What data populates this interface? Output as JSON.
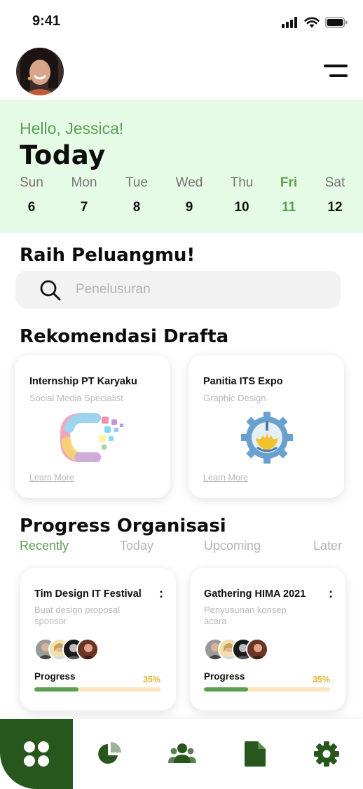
{
  "status_bar": {
    "time": "9:41",
    "icons": [
      "signal-icon",
      "wifi-icon",
      "battery-icon"
    ]
  },
  "header": {
    "avatar": "profile-avatar",
    "menu_icon": "hamburger-menu-icon"
  },
  "today": {
    "greeting": "Hello, Jessica!",
    "title": "Today",
    "days": [
      {
        "name": "Sun",
        "num": "6"
      },
      {
        "name": "Mon",
        "num": "7"
      },
      {
        "name": "Tue",
        "num": "8"
      },
      {
        "name": "Wed",
        "num": "9"
      },
      {
        "name": "Thu",
        "num": "10"
      },
      {
        "name": "Fri",
        "num": "11",
        "active": true
      },
      {
        "name": "Sat",
        "num": "12"
      }
    ]
  },
  "search": {
    "title": "Raih Peluangmu!",
    "placeholder": "Penelusuran"
  },
  "recommendations": {
    "title": "Rekomendasi Drafta",
    "cards": [
      {
        "title": "Internship PT Karyaku",
        "subtitle": "Social Media Specialist",
        "link": "Learn More",
        "logo": "karyaku-logo"
      },
      {
        "title": "Panitia ITS Expo",
        "subtitle": "Graphic Design",
        "link": "Learn More",
        "logo": "its-logo"
      }
    ]
  },
  "progress": {
    "title": "Progress Organisasi",
    "tabs": [
      "Recently",
      "Today",
      "Upcoming",
      "Later"
    ],
    "active_tab": "Recently",
    "cards": [
      {
        "title": "Tim Design IT Festival",
        "desc": "Buat design proposal sponsor",
        "label": "Progress",
        "percent_text": "35%",
        "percent": 35,
        "more": ":"
      },
      {
        "title": "Gathering HIMA 2021",
        "desc": "Penyusunan konsep acara",
        "label": "Progress",
        "percent_text": "35%",
        "percent": 35,
        "more": ":"
      }
    ]
  },
  "bottom_nav": {
    "items": [
      "home-grid-icon",
      "pie-chart-icon",
      "people-icon",
      "document-icon",
      "settings-gear-icon"
    ],
    "active": "home-grid-icon"
  },
  "colors": {
    "accent_green": "#5ba04e",
    "dark_green": "#27571c",
    "panel_bg": "#e6fbe6",
    "progress_track": "#fbe7bb",
    "percent_text": "#e8b438"
  }
}
